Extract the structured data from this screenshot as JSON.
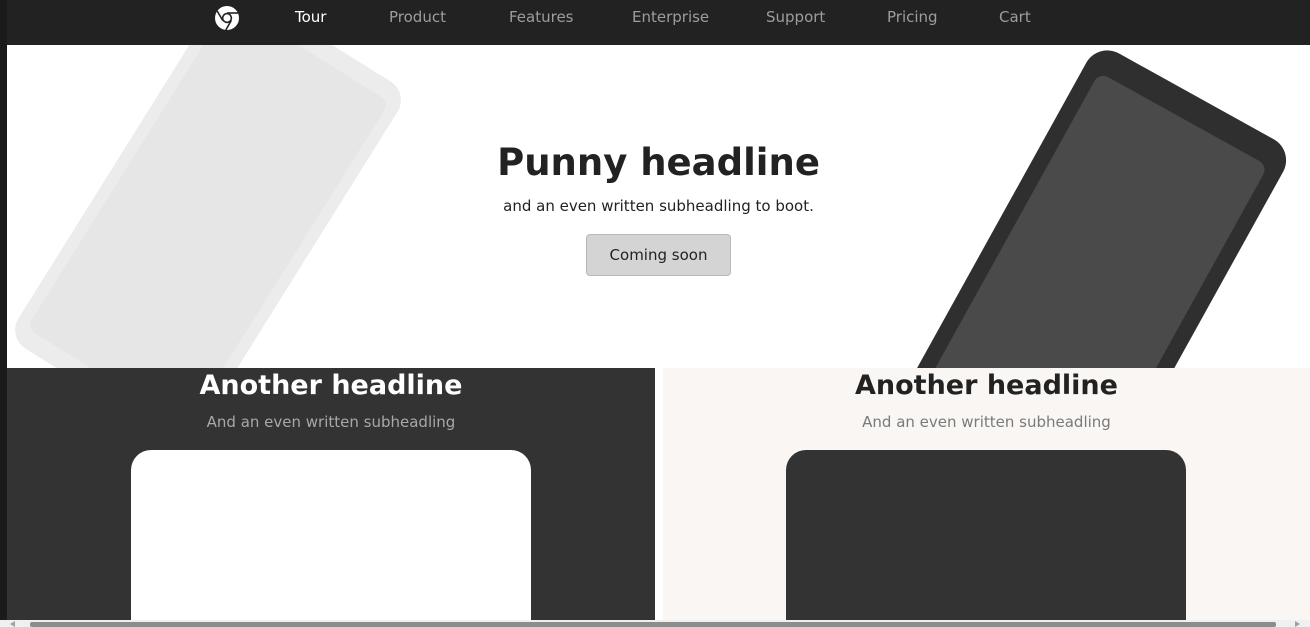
{
  "navbar": {
    "logo_icon": "chrome-logo-icon",
    "items": [
      {
        "label": "Tour",
        "active": true
      },
      {
        "label": "Product",
        "active": false
      },
      {
        "label": "Features",
        "active": false
      },
      {
        "label": "Enterprise",
        "active": false
      },
      {
        "label": "Support",
        "active": false
      },
      {
        "label": "Pricing",
        "active": false
      },
      {
        "label": "Cart",
        "active": false
      }
    ]
  },
  "hero": {
    "title": "Punny headline",
    "subtitle": "and an even written subheadling to boot.",
    "button_label": "Coming soon"
  },
  "panels": [
    {
      "title": "Another headline",
      "subtitle": "And an even written subheadling",
      "theme": "dark"
    },
    {
      "title": "Another headline",
      "subtitle": "And an even written subheadling",
      "theme": "light"
    }
  ],
  "colors": {
    "navbar_bg": "#222222",
    "nav_active": "#ffffff",
    "nav_inactive": "#9d9d9d",
    "dark_panel": "#333333",
    "light_panel": "#f9f6f4",
    "button_bg": "#d4d4d4"
  }
}
